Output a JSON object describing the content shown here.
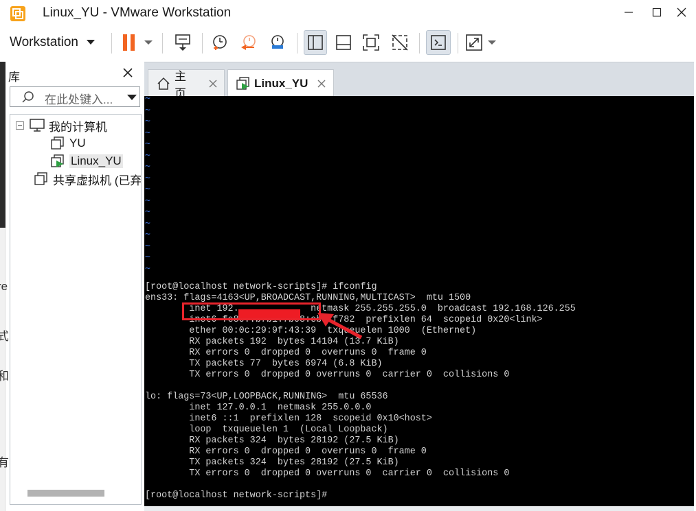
{
  "window": {
    "title": "Linux_YU - VMware Workstation",
    "minimize": "—",
    "maximize": "☐",
    "close": "✕"
  },
  "toolbar": {
    "workstation_label": "Workstation"
  },
  "library": {
    "title": "库",
    "search_placeholder": "在此处键入...",
    "tree": [
      {
        "label": "我的计算机",
        "expander": "⊟"
      },
      {
        "label": "YU"
      },
      {
        "label": "Linux_YU"
      },
      {
        "label": "共享虚拟机 (已弃"
      }
    ]
  },
  "left_edge_chars": [
    "re",
    "式",
    "和",
    "有"
  ],
  "tabs": [
    {
      "label": "主页"
    },
    {
      "label": "Linux_YU"
    }
  ],
  "console": {
    "tilde_char": "~",
    "lines": [
      "[root@localhost network-scripts]# ifconfig",
      "ens33: flags=4163<UP,BROADCAST,RUNNING,MULTICAST>  mtu 1500",
      "        inet 192.             netmask 255.255.255.0  broadcast 192.168.126.255",
      "        inet6 fe80::b7b1:7b08:eb  f782  prefixlen 64  scopeid 0x20<link>",
      "        ether 00:0c:29:9f:43:39  txqueuelen 1000  (Ethernet)",
      "        RX packets 192  bytes 14104 (13.7 KiB)",
      "        RX errors 0  dropped 0  overruns 0  frame 0",
      "        TX packets 77  bytes 6974 (6.8 KiB)",
      "        TX errors 0  dropped 0 overruns 0  carrier 0  collisions 0",
      "",
      "lo: flags=73<UP,LOOPBACK,RUNNING>  mtu 65536",
      "        inet 127.0.0.1  netmask 255.0.0.0",
      "        inet6 ::1  prefixlen 128  scopeid 0x10<host>",
      "        loop  txqueuelen 1  (Local Loopback)",
      "        RX packets 324  bytes 28192 (27.5 KiB)",
      "        RX errors 0  dropped 0  overruns 0  frame 0",
      "        TX packets 324  bytes 28192 (27.5 KiB)",
      "        TX errors 0  dropped 0 overruns 0  carrier 0  collisions 0",
      "",
      "[root@localhost network-scripts]#"
    ]
  },
  "colors": {
    "annotation_red": "#e8242c",
    "redaction_red": "#ee1c24",
    "vim_tilde_blue": "#3a6fd6",
    "pause_orange": "#f26522"
  }
}
